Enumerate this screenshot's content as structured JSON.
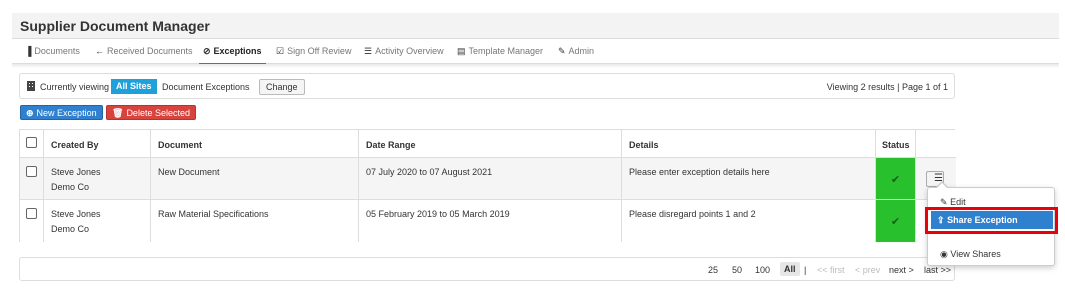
{
  "app": {
    "title": "Supplier Document Manager"
  },
  "nav": [
    {
      "label": "Documents",
      "icon": "document-icon",
      "glyph": "▐"
    },
    {
      "label": "Received Documents",
      "icon": "arrow-left-icon",
      "glyph": "←"
    },
    {
      "label": "Exceptions",
      "icon": "check-circle-icon",
      "glyph": "⊘"
    },
    {
      "label": "Sign Off Review",
      "icon": "check-square-icon",
      "glyph": "☑"
    },
    {
      "label": "Activity Overview",
      "icon": "list-icon",
      "glyph": "☰"
    },
    {
      "label": "Template Manager",
      "icon": "template-icon",
      "glyph": "▤"
    },
    {
      "label": "Admin",
      "icon": "wrench-icon",
      "glyph": "✎"
    }
  ],
  "active_tab": "Exceptions",
  "viewbar": {
    "prefix": "Currently viewing",
    "sites_badge": "All Sites",
    "section": "Document Exceptions",
    "change_label": "Change",
    "results": "Viewing 2 results | Page 1 of 1"
  },
  "actions": {
    "new_label": "New Exception",
    "delete_label": "Delete Selected"
  },
  "table": {
    "headers": [
      "Created By",
      "Document",
      "Date Range",
      "Details",
      "Status"
    ],
    "rows": [
      {
        "created_by": "Steve Jones",
        "company": "Demo Co",
        "document": "New Document",
        "date_range": "07 July 2020 to 07 August 2021",
        "details": "Please enter exception details here",
        "status": "approved"
      },
      {
        "created_by": "Steve Jones",
        "company": "Demo Co",
        "document": "Raw Material Specifications",
        "date_range": "05 February 2019 to 05 March 2019",
        "details": "Please disregard points 1 and 2",
        "status": "approved"
      }
    ]
  },
  "pager": {
    "sizes": [
      "25",
      "50",
      "100",
      "All"
    ],
    "separator": "|",
    "first": "<< first",
    "prev": "< prev",
    "next": "next >",
    "last": "last >>"
  },
  "row_menu": {
    "edit": "Edit",
    "share": "Share Exception",
    "view_shares": "View Shares"
  },
  "colors": {
    "accent": "#2f80cf",
    "danger": "#d9433e",
    "status_ok": "#29c02e",
    "highlight": "#e8000c"
  }
}
